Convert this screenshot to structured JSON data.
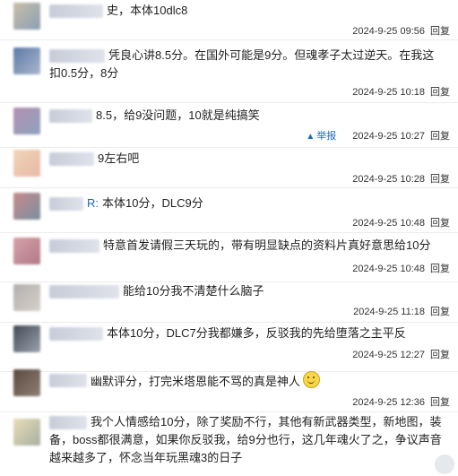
{
  "comments": [
    {
      "prefix": "",
      "body": "史，本体10dlc8",
      "timestamp": "2024-9-25 09:56",
      "reply_label": "回复",
      "report_label": "",
      "emoji": ""
    },
    {
      "prefix": "",
      "body": "凭良心讲8.5分。在国外可能是9分。但魂孝子太过逆天。在我这扣0.5分，8分",
      "timestamp": "2024-9-25 10:18",
      "reply_label": "回复",
      "report_label": "",
      "emoji": ""
    },
    {
      "prefix": "",
      "body": "8.5，给9没问题，10就是纯搞笑",
      "timestamp": "2024-9-25 10:27",
      "reply_label": "回复",
      "report_label": "举报",
      "emoji": ""
    },
    {
      "prefix": "",
      "body": "9左右吧",
      "timestamp": "2024-9-25 10:28",
      "reply_label": "回复",
      "report_label": "",
      "emoji": ""
    },
    {
      "prefix": "R:",
      "body": "本体10分，DLC9分",
      "timestamp": "2024-9-25 10:48",
      "reply_label": "回复",
      "report_label": "",
      "emoji": ""
    },
    {
      "prefix": "",
      "body": "特意首发请假三天玩的，带有明显缺点的资料片真好意思给10分",
      "timestamp": "2024-9-25 10:48",
      "reply_label": "回复",
      "report_label": "",
      "emoji": ""
    },
    {
      "prefix": "",
      "body": "能给10分我不清楚什么脑子",
      "timestamp": "2024-9-25 11:18",
      "reply_label": "回复",
      "report_label": "",
      "emoji": ""
    },
    {
      "prefix": "",
      "body": "本体10分，DLC7分我都嫌多，反驳我的先给堕落之主平反",
      "timestamp": "2024-9-25 12:27",
      "reply_label": "回复",
      "report_label": "",
      "emoji": ""
    },
    {
      "prefix": "",
      "body": "幽默评分，打完米塔恩能不骂的真是神人",
      "timestamp": "2024-9-25 12:36",
      "reply_label": "回复",
      "report_label": "",
      "emoji": "smile-emoji"
    },
    {
      "prefix": "",
      "body": "我个人情感给10分，除了奖励不行，其他有新武器类型，新地图，装备，boss都很满意，如果你反驳我，给9分也行，这几年魂火了之，争议声音越来越多了，怀念当年玩黑魂3的日子",
      "timestamp": "",
      "reply_label": "",
      "report_label": "",
      "emoji": ""
    }
  ],
  "colors": {
    "link": "#1b6bbd",
    "divider": "#ececec",
    "text": "#222222"
  },
  "icons": {
    "report": "warning-triangle-icon",
    "emoji": "smile-emoji"
  }
}
